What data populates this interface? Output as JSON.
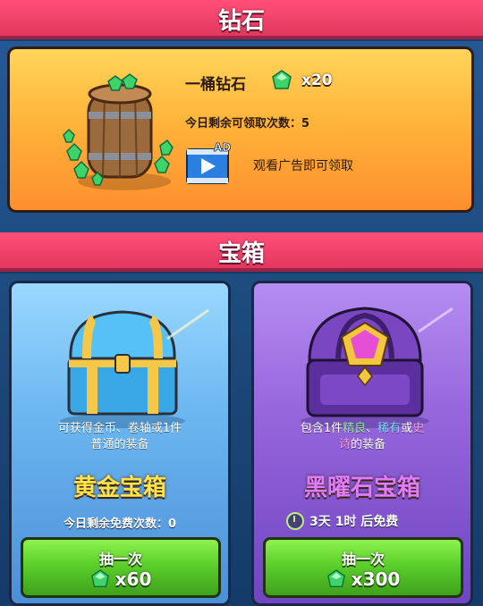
{
  "sections": {
    "diamond_title": "钻石",
    "chest_title": "宝箱"
  },
  "diamond_offer": {
    "name": "一桶钻石",
    "amount": "x20",
    "remaining": "今日剩余可领取次数：5",
    "ad_badge": "AD",
    "ad_text": "观看广告即可领取"
  },
  "gold_chest": {
    "desc_line1": "可获得金币、卷轴或1件",
    "desc_line2": "普通的装备",
    "name": "黄金宝箱",
    "free_left": "今日剩余免费次数：0",
    "button_label": "抽一次",
    "price": "x60"
  },
  "obsidian_chest": {
    "desc_prefix": "包含1件",
    "desc_q1": "精良",
    "desc_sep1": "、",
    "desc_q2": "稀有",
    "desc_sep2": "或",
    "desc_q3": "史",
    "desc_line2_hl": "诗",
    "desc_line2_rest": "的装备",
    "name": "黑曜石宝箱",
    "timer": "3天 1时 后免费",
    "button_label": "抽一次",
    "price": "x300"
  },
  "colors": {
    "banner": "#e2375e",
    "diamond_card": "#ffb43a",
    "gold_card": "#6cb7f1",
    "obsidian_card": "#9666dc",
    "button": "#5bcf2b",
    "gem": "#3fd46b"
  },
  "icons": {
    "gem": "green-gem-icon",
    "ad": "video-ad-icon",
    "timer": "clock-timer-icon"
  }
}
